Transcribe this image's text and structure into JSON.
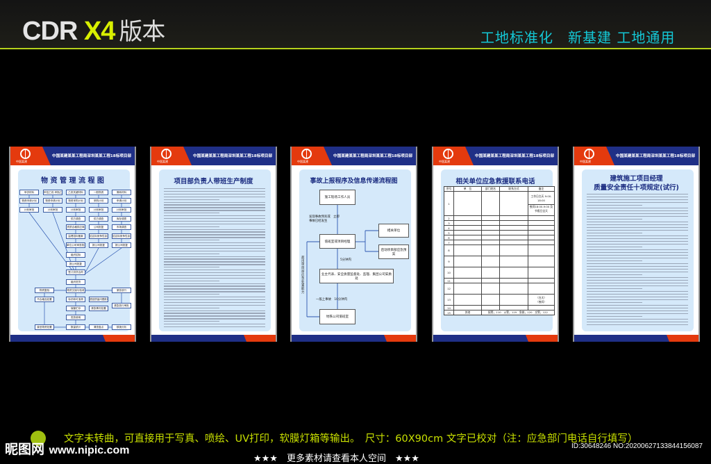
{
  "header": {
    "brand_main": "CDR ",
    "brand_version": "X4",
    "brand_suffix": "版本",
    "slogan": "工地标准化　新基建 工地通用"
  },
  "poster_common": {
    "org": "中国某建某某工程局深圳某某工程18标项目部",
    "logo_text": "中国某建"
  },
  "poster1": {
    "title": "物 资 管 理 流 程 图",
    "flow": [
      "甲供材料",
      "物资申请计划",
      "计划审批",
      "甲控乙供,甲指乙供",
      "物资申请计划",
      "计划审批",
      "乙供关键材料",
      "物资采购计划",
      "计划审批",
      "供方调查",
      "资质合格供应商",
      "监理招标备案",
      "单位公司审查批准",
      "组织招标",
      "报公司批复",
      "签订供货合同",
      "组织进货",
      "一般物资",
      "采购计划",
      "计划审批",
      "供方调查",
      "公司批复",
      "招议标竞争性谈判",
      "报公司批复",
      "周转材料",
      "申请计划",
      "计划审批",
      "库存调拨",
      "市场调查",
      "招议标竞争性谈判",
      "报公司批复",
      "物资复验",
      "物资交接与验收",
      "紧急放行",
      "不合格品处置",
      "标识和可追溯",
      "退回质量问题处理",
      "紧急放行审批",
      "保管贮存",
      "紧急情况处置",
      "发放使用",
      "废旧物资处置",
      "数量统计",
      "清查盘点",
      "核销分析"
    ]
  },
  "poster2": {
    "title": "项目部负责人带班生产制度"
  },
  "poster3": {
    "title": "事故上报程序及信息传递流程图",
    "nodes": {
      "worker": "施工现场工作人员",
      "duty": "值班室或项目经理",
      "related": "相关单位",
      "plan": "启动项目部应急预案",
      "owner": "业主代表、安全质量监督处、监理、集团公司安质处",
      "metro": "地铁公司值班室"
    },
    "labels": {
      "found": "发现事故预兆或　立即",
      "found2": "事故已经发生",
      "five": "5分钟内",
      "general": "一般上事故　10分钟内",
      "exceed": "超出项目部应急处置能力"
    }
  },
  "poster4": {
    "title": "相关单位应急救援联系电话",
    "headers": [
      "序号",
      "单　位",
      "部门姓名",
      "联系方式",
      "备注"
    ],
    "row1_notes": [
      "工作日白天 9:00-18:00",
      "夜间18:00-9:00 及节假日全天"
    ],
    "rows": [
      "1",
      "2",
      "3",
      "4",
      "5",
      "6",
      "7",
      "8",
      "9",
      "10",
      "11",
      "12",
      "13",
      "14",
      "15"
    ],
    "row13_notes": [
      "（白天）",
      "（夜间）"
    ],
    "row15": {
      "unit": "其他",
      "phones": "报警，110　火警，119　急救，120　交警，122"
    }
  },
  "poster5": {
    "title_line1": "建筑施工项目经理",
    "title_line2": "质量安全责任十项规定(试行)"
  },
  "footer": {
    "note": "文字未转曲，可直接用于写真、喷绘、UV打印，软膜灯箱等输出。　尺寸：60X90cm 文字已校对（注：应急部门电话自行填写）",
    "watermark_name": "昵图网",
    "watermark_url": "www.nipic.com",
    "id_text": "ID:30648246 NO:20200627133844156087",
    "more": "★★★　更多素材请查看本人空间　★★★"
  },
  "colors": {
    "accent_blue": "#1f2f86",
    "accent_red": "#e43a0e",
    "slogan": "#14c8d6",
    "note": "#c8e000"
  }
}
